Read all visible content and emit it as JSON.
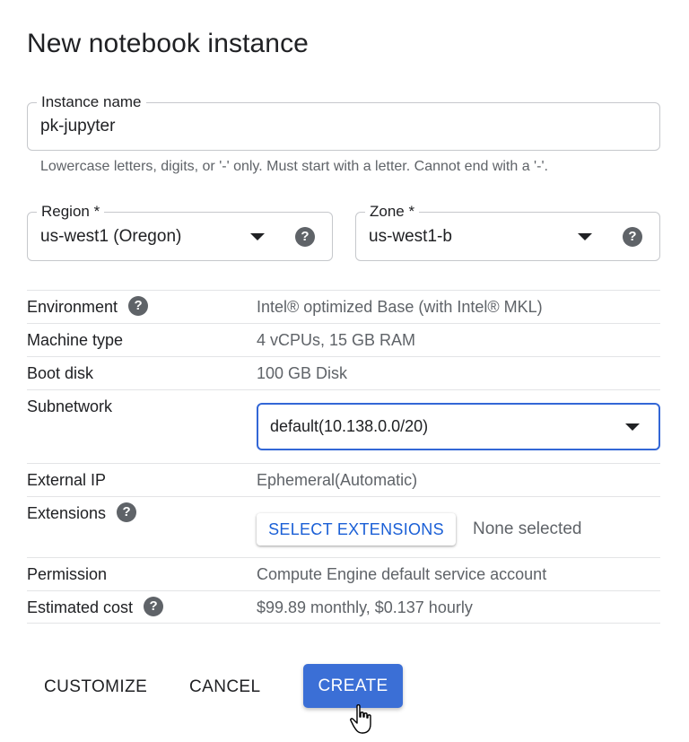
{
  "dialog": {
    "title": "New notebook instance"
  },
  "instance_name": {
    "label": "Instance name",
    "value": "pk-jupyter",
    "hint": "Lowercase letters, digits, or '-' only. Must start with a letter. Cannot end with a '-'."
  },
  "region": {
    "label": "Region *",
    "value": "us-west1 (Oregon)"
  },
  "zone": {
    "label": "Zone *",
    "value": "us-west1-b"
  },
  "details": {
    "environment": {
      "label": "Environment",
      "value": "Intel® optimized Base (with Intel® MKL)"
    },
    "machine_type": {
      "label": "Machine type",
      "value": "4 vCPUs, 15 GB RAM"
    },
    "boot_disk": {
      "label": "Boot disk",
      "value": "100 GB Disk"
    },
    "subnetwork": {
      "label": "Subnetwork",
      "value": "default(10.138.0.0/20)"
    },
    "external_ip": {
      "label": "External IP",
      "value": "Ephemeral(Automatic)"
    },
    "extensions": {
      "label": "Extensions",
      "button": "SELECT EXTENSIONS",
      "status": "None selected"
    },
    "permission": {
      "label": "Permission",
      "value": "Compute Engine default service account"
    },
    "estimated_cost": {
      "label": "Estimated cost",
      "value": "$99.89 monthly, $0.137 hourly"
    }
  },
  "actions": {
    "customize": "CUSTOMIZE",
    "cancel": "CANCEL",
    "create": "CREATE"
  },
  "icons": {
    "help": "?",
    "help_icon_name": "help-circle-icon",
    "dropdown_icon_name": "caret-down-icon",
    "cursor_icon_name": "hand-pointer-icon"
  },
  "colors": {
    "primary": "#3b6fd6",
    "focus_border": "#3367d6",
    "link_blue": "#1a5fd6",
    "muted_text": "#5f6368"
  }
}
